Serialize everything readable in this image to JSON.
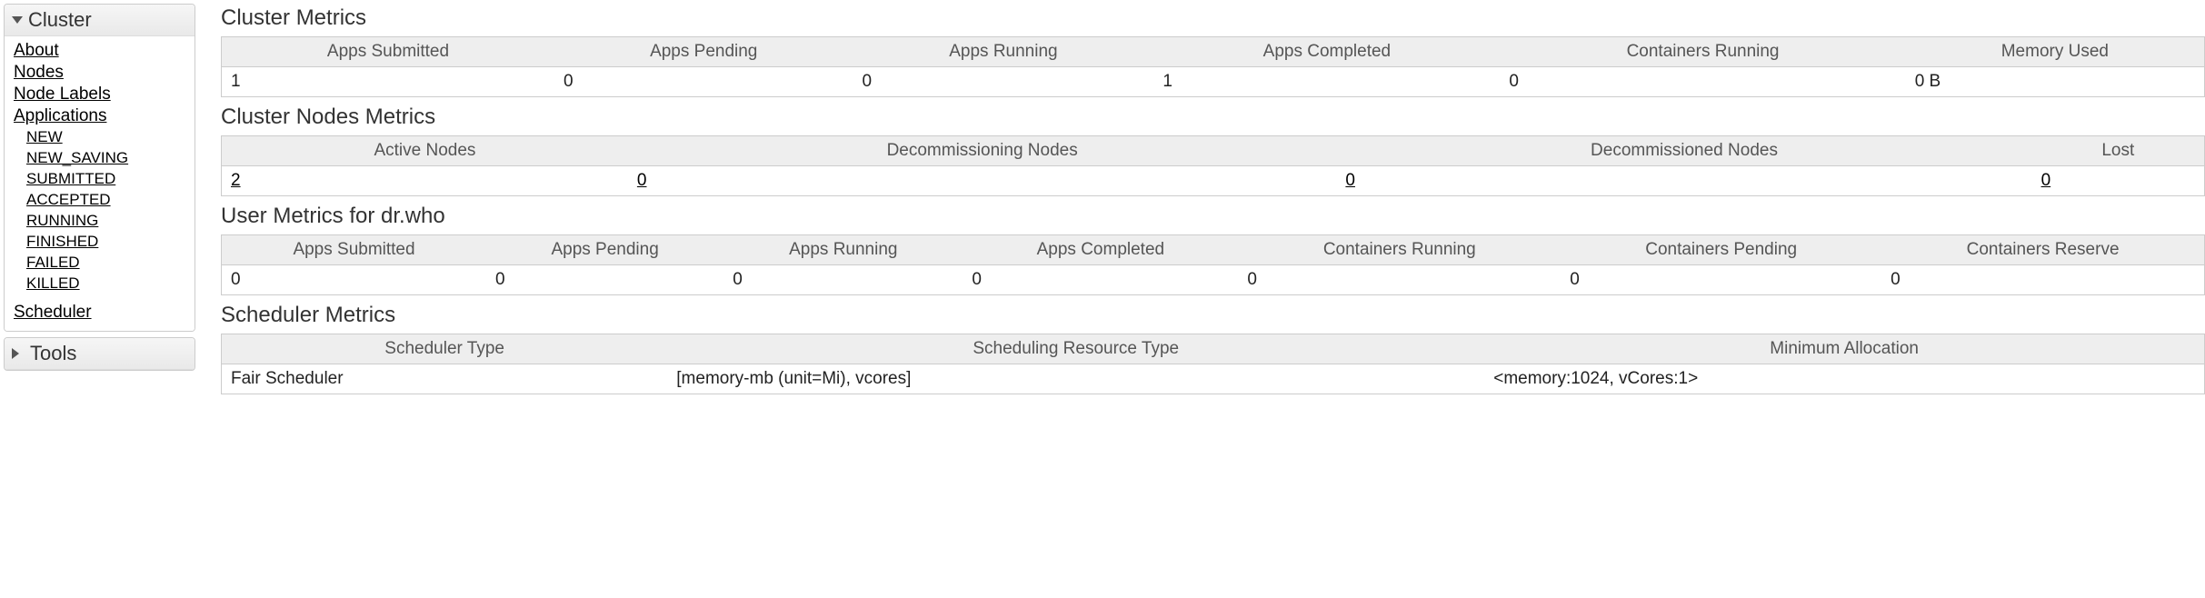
{
  "sidebar": {
    "sections": [
      {
        "label": "Cluster",
        "expanded": true,
        "items": [
          {
            "label": "About"
          },
          {
            "label": "Nodes"
          },
          {
            "label": "Node Labels"
          },
          {
            "label": "Applications",
            "children": [
              {
                "label": "NEW"
              },
              {
                "label": "NEW_SAVING"
              },
              {
                "label": "SUBMITTED"
              },
              {
                "label": "ACCEPTED"
              },
              {
                "label": "RUNNING"
              },
              {
                "label": "FINISHED"
              },
              {
                "label": "FAILED"
              },
              {
                "label": "KILLED"
              }
            ]
          },
          {
            "label": "Scheduler"
          }
        ]
      },
      {
        "label": "Tools",
        "expanded": false
      }
    ]
  },
  "main": {
    "cluster_metrics": {
      "title": "Cluster Metrics",
      "headers": [
        "Apps Submitted",
        "Apps Pending",
        "Apps Running",
        "Apps Completed",
        "Containers Running",
        "Memory Used"
      ],
      "row": [
        "1",
        "0",
        "0",
        "1",
        "0",
        "0 B"
      ]
    },
    "cluster_nodes_metrics": {
      "title": "Cluster Nodes Metrics",
      "headers": [
        "Active Nodes",
        "Decommissioning Nodes",
        "Decommissioned Nodes",
        "Lost"
      ],
      "row": [
        "2",
        "0",
        "0",
        "0"
      ]
    },
    "user_metrics": {
      "title": "User Metrics for dr.who",
      "headers": [
        "Apps Submitted",
        "Apps Pending",
        "Apps Running",
        "Apps Completed",
        "Containers Running",
        "Containers Pending",
        "Containers Reserve"
      ],
      "row": [
        "0",
        "0",
        "0",
        "0",
        "0",
        "0",
        "0"
      ]
    },
    "scheduler_metrics": {
      "title": "Scheduler Metrics",
      "headers": [
        "Scheduler Type",
        "Scheduling Resource Type",
        "Minimum Allocation"
      ],
      "row": [
        "Fair Scheduler",
        "[memory-mb (unit=Mi), vcores]",
        "<memory:1024, vCores:1>"
      ]
    }
  }
}
